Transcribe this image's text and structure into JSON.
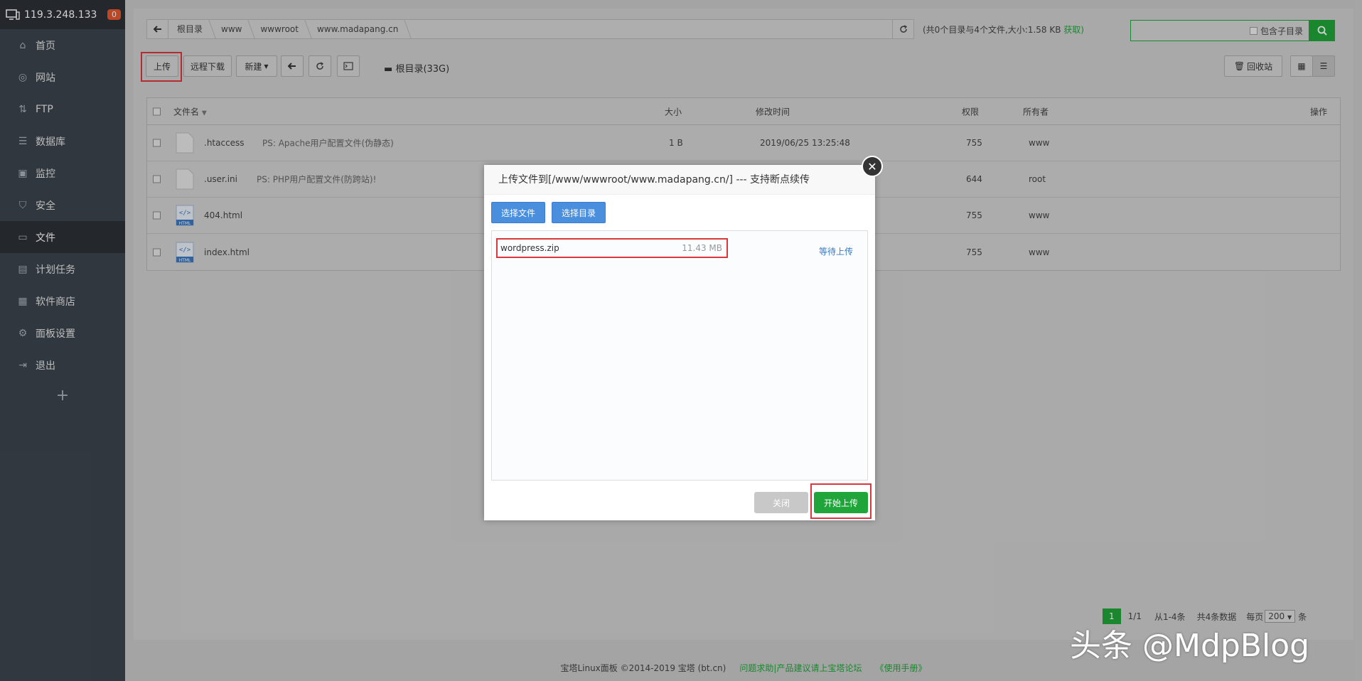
{
  "sidebar": {
    "ip": "119.3.248.133",
    "badge": "0",
    "items": [
      {
        "label": "首页"
      },
      {
        "label": "网站"
      },
      {
        "label": "FTP"
      },
      {
        "label": "数据库"
      },
      {
        "label": "监控"
      },
      {
        "label": "安全"
      },
      {
        "label": "文件"
      },
      {
        "label": "计划任务"
      },
      {
        "label": "软件商店"
      },
      {
        "label": "面板设置"
      },
      {
        "label": "退出"
      }
    ],
    "add": "+"
  },
  "path": {
    "crumbs": [
      "根目录",
      "www",
      "wwwroot",
      "www.madapang.cn"
    ],
    "summary": "(共0个目录与4个文件,大小:1.58 KB",
    "get": "获取)"
  },
  "search": {
    "subdir_label": "包含子目录"
  },
  "toolbar": {
    "upload": "上传",
    "remote_download": "远程下载",
    "new": "新建",
    "disk": "根目录(33G)",
    "recycle": "回收站"
  },
  "table": {
    "headers": {
      "name": "文件名",
      "size": "大小",
      "mtime": "修改时间",
      "perm": "权限",
      "owner": "所有者",
      "ops": "操作"
    },
    "rows": [
      {
        "name": ".htaccess",
        "note": "PS: Apache用户配置文件(伪静态)",
        "size": "1 B",
        "mtime": "2019/06/25 13:25:48",
        "perm": "755",
        "owner": "www"
      },
      {
        "name": ".user.ini",
        "note": "PS: PHP用户配置文件(防跨站)!",
        "size": "",
        "mtime": "",
        "perm": "644",
        "owner": "root"
      },
      {
        "name": "404.html",
        "note": "",
        "size": "",
        "mtime": "",
        "perm": "755",
        "owner": "www"
      },
      {
        "name": "index.html",
        "note": "",
        "size": "",
        "mtime": "",
        "perm": "755",
        "owner": "www"
      }
    ]
  },
  "dialog": {
    "title": "上传文件到[/www/wwwroot/www.madapang.cn/] --- 支持断点续传",
    "choose_file": "选择文件",
    "choose_dir": "选择目录",
    "file_name": "wordpress.zip",
    "file_size": "11.43 MB",
    "status": "等待上传",
    "close": "关闭",
    "start": "开始上传"
  },
  "pager": {
    "current": "1",
    "pages": "1/1",
    "range": "从1-4条",
    "total": "共4条数据",
    "per_page_label": "每页",
    "per_page": "200",
    "unit": "条"
  },
  "footer": {
    "copyright": "宝塔Linux面板 ©2014-2019 宝塔 (bt.cn)",
    "forum": "问题求助|产品建议请上宝塔论坛",
    "manual": "《使用手册》"
  },
  "watermark": "头条 @MdpBlog"
}
